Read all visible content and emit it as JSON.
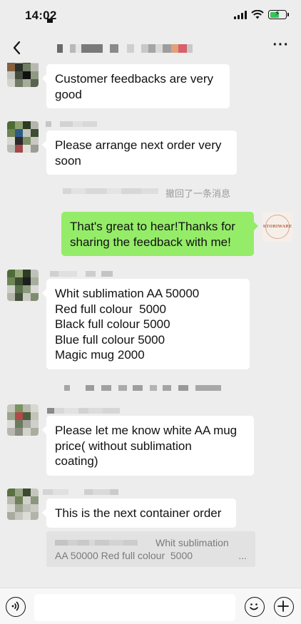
{
  "status_bar": {
    "time": "14:02",
    "icons": [
      "signal-icon",
      "wifi-icon",
      "battery-charging-icon"
    ]
  },
  "nav": {
    "back_icon": "chevron-left-icon",
    "more_icon": "more-dots-icon",
    "more_label": "···"
  },
  "messages": [
    {
      "id": "m1",
      "direction": "incoming",
      "lines": [
        "Customer feedbacks are very",
        "good"
      ]
    },
    {
      "id": "m2",
      "direction": "incoming",
      "lines": [
        "Please arrange next order very",
        "soon"
      ]
    },
    {
      "id": "recall",
      "type": "system",
      "text": "撤回了一条消息"
    },
    {
      "id": "m3",
      "direction": "outgoing",
      "lines": [
        "That's great to hear!Thanks for",
        "sharing the feedback with me!"
      ],
      "avatar_text": "STORIWARE"
    },
    {
      "id": "m4",
      "direction": "incoming",
      "lines": [
        "Whit sublimation AA 50000",
        "Red full colour  5000",
        "Black full colour 5000",
        "Blue full colour 5000",
        "Magic mug 2000"
      ]
    },
    {
      "id": "m5",
      "direction": "incoming",
      "lines": [
        "Please let me know white AA mug",
        "price( without sublimation",
        "coating)"
      ]
    },
    {
      "id": "m6",
      "direction": "incoming",
      "lines": [
        "This is the next container order"
      ],
      "quote": {
        "line1": "Whit sublimation",
        "line2": "AA 50000 Red full colour  5000",
        "ellipsis": "..."
      }
    }
  ],
  "input_bar": {
    "voice_icon": "voice-icon",
    "emoji_icon": "emoji-icon",
    "plus_icon": "plus-icon",
    "input_value": ""
  },
  "colors": {
    "background": "#ededed",
    "incoming_bubble": "#ffffff",
    "outgoing_bubble": "#95ec69",
    "system_text": "#9a9a9a",
    "storiware_brand": "#b86b4f"
  }
}
